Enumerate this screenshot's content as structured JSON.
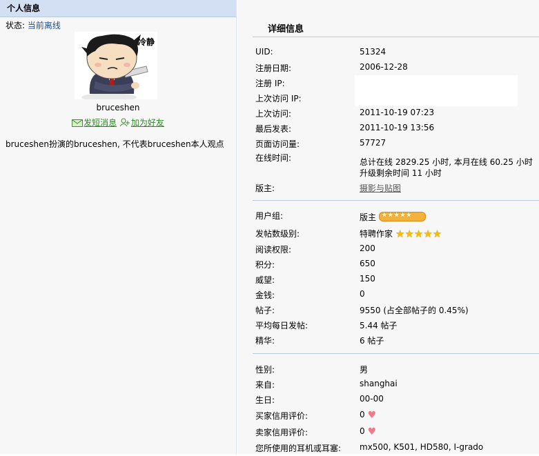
{
  "left": {
    "header": "个人信息",
    "status_label": "状态:",
    "status_value": "当前离线",
    "avatar_caption": "冷静",
    "username": "bruceshen",
    "send_message": "发短消息",
    "add_friend": "加为好友",
    "signature": "bruceshen扮演的bruceshen, 不代表bruceshen本人观点"
  },
  "right": {
    "title": "详细信息",
    "uid_label": "UID:",
    "uid_value": "51324",
    "regdate_label": "注册日期:",
    "regdate_value": "2006-12-28",
    "regip_label": "注册 IP:",
    "lastip_label": "上次访问 IP:",
    "lastvisit_label": "上次访问:",
    "lastvisit_value": "2011-10-19 07:23",
    "lastpost_label": "最后发表:",
    "lastpost_value": "2011-10-19 13:56",
    "pageviews_label": "页面访问量:",
    "pageviews_value": "57727",
    "online_label": "在线时间:",
    "online_value_1": "总计在线 2829.25 小时, 本月在线 60.25 小时",
    "online_value_2": "升级剩余时间 11 小时",
    "moderator_label": "版主:",
    "moderator_value": "摄影与贴图",
    "usergroup_label": "用户组:",
    "usergroup_value": "版主",
    "postlevel_label": "发帖数级别:",
    "postlevel_value": "特聘作家",
    "readperm_label": "阅读权限:",
    "readperm_value": "200",
    "points_label": "积分:",
    "points_value": "650",
    "prestige_label": "威望:",
    "prestige_value": "150",
    "money_label": "金钱:",
    "money_value": "0",
    "posts_label": "帖子:",
    "posts_value": "9550 (占全部帖子的 0.45%)",
    "avgposts_label": "平均每日发帖:",
    "avgposts_value": "5.44 帖子",
    "digest_label": "精华:",
    "digest_value": "6 帖子",
    "gender_label": "性别:",
    "gender_value": "男",
    "from_label": "来自:",
    "from_value": "shanghai",
    "birthday_label": "生日:",
    "birthday_value": "00-00",
    "buyer_label": "买家信用评价:",
    "buyer_value": "0",
    "seller_label": "卖家信用评价:",
    "seller_value": "0",
    "headphones_label": "您所使用的耳机或耳塞:",
    "headphones_value": "mx500, K501, HD580, I-grado"
  },
  "colors": {
    "header_bg": "#d3e0f3",
    "link": "#1e4f8c",
    "action_link": "#2b8a24",
    "separator": "#b9cde6",
    "star": "#f6c000",
    "heart": "#f07a8a"
  },
  "icons": {
    "send_message": "envelope-icon",
    "add_friend": "add-friend-icon",
    "usergroup_rank": "rank-badge-icon",
    "post_level": "star-icon",
    "credit": "heart-icon"
  }
}
